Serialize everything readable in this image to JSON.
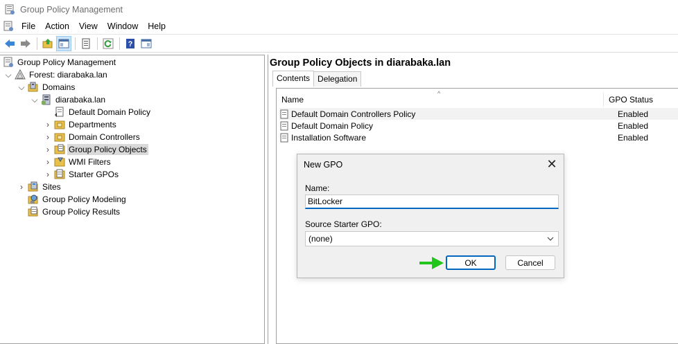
{
  "window": {
    "title": "Group Policy Management"
  },
  "menu": [
    "File",
    "Action",
    "View",
    "Window",
    "Help"
  ],
  "toolbar": {
    "buttons": [
      "back-arrow-icon",
      "forward-arrow-icon",
      "up-folder-icon",
      "show-hide-tree-icon",
      "properties-icon",
      "refresh-icon",
      "help-icon",
      "console-icon"
    ]
  },
  "tree": {
    "root": "Group Policy Management",
    "forest": "Forest: diarabaka.lan",
    "domains": "Domains",
    "domain": "diarabaka.lan",
    "default_domain_policy": "Default Domain Policy",
    "departments": "Departments",
    "domain_controllers": "Domain Controllers",
    "gpo": "Group Policy Objects",
    "wmi": "WMI Filters",
    "starter": "Starter GPOs",
    "sites": "Sites",
    "modeling": "Group Policy Modeling",
    "results": "Group Policy Results"
  },
  "right": {
    "title": "Group Policy Objects in diarabaka.lan",
    "tabs": [
      "Contents",
      "Delegation"
    ],
    "columns": {
      "name": "Name",
      "status": "GPO Status"
    },
    "rows": [
      {
        "name": "Default Domain Controllers Policy",
        "status": "Enabled"
      },
      {
        "name": "Default Domain Policy",
        "status": "Enabled"
      },
      {
        "name": "Installation Software",
        "status": "Enabled"
      }
    ]
  },
  "dialog": {
    "title": "New GPO",
    "name_label": "Name:",
    "name_value": "BitLocker",
    "source_label": "Source Starter GPO:",
    "source_value": "(none)",
    "ok": "OK",
    "cancel": "Cancel"
  },
  "colors": {
    "accent": "#0067c0",
    "pointer_arrow": "#22c51a",
    "selection": "#d9d9d9"
  }
}
